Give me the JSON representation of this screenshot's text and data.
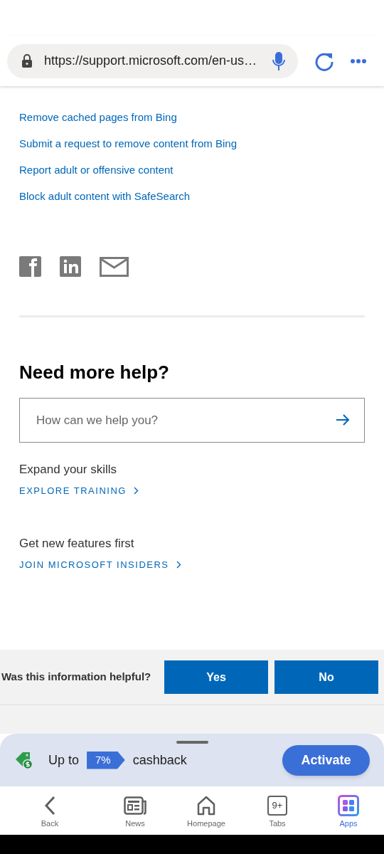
{
  "address_bar": {
    "url": "https://support.microsoft.com/en-us…"
  },
  "related_links": [
    "Remove cached pages from Bing",
    "Submit a request to remove content from Bing",
    "Report adult or offensive content",
    "Block adult content with SafeSearch"
  ],
  "help": {
    "title": "Need more help?",
    "search_placeholder": "How can we help you?",
    "sections": [
      {
        "heading": "Expand your skills",
        "link": "EXPLORE TRAINING"
      },
      {
        "heading": "Get new features first",
        "link": "JOIN MICROSOFT INSIDERS"
      }
    ]
  },
  "feedback": {
    "question": "Was this information helpful?",
    "buttons": [
      "Yes",
      "No"
    ]
  },
  "cashback": {
    "prefix": "Up to",
    "rate": "7%",
    "suffix": "cashback",
    "button": "Activate"
  },
  "nav": [
    {
      "kind": "back",
      "label": "Back",
      "selected": false
    },
    {
      "kind": "news",
      "label": "News",
      "selected": false
    },
    {
      "kind": "home",
      "label": "Homepage",
      "selected": false
    },
    {
      "kind": "tabs",
      "label": "Tabs",
      "count": "9+",
      "selected": false
    },
    {
      "kind": "apps",
      "label": "Apps",
      "selected": true
    }
  ]
}
